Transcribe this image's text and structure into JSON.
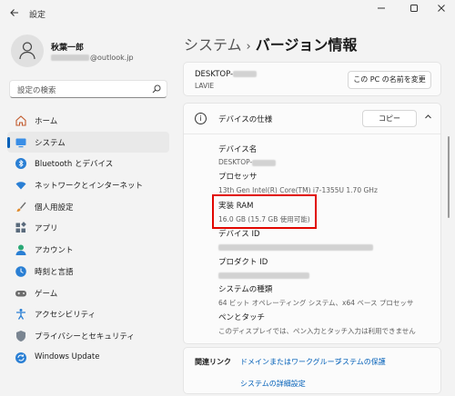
{
  "window": {
    "title": "設定",
    "controls": [
      "minimize",
      "maximize",
      "close"
    ]
  },
  "profile": {
    "name": "秋葉一郎",
    "email_domain": "@outlook.jp"
  },
  "search": {
    "placeholder": "設定の検索"
  },
  "nav": {
    "items": [
      {
        "label": "ホーム",
        "icon": "home-icon"
      },
      {
        "label": "システム",
        "icon": "system-icon",
        "active": true
      },
      {
        "label": "Bluetooth とデバイス",
        "icon": "bluetooth-icon"
      },
      {
        "label": "ネットワークとインターネット",
        "icon": "wifi-icon"
      },
      {
        "label": "個人用設定",
        "icon": "brush-icon"
      },
      {
        "label": "アプリ",
        "icon": "apps-icon"
      },
      {
        "label": "アカウント",
        "icon": "account-icon"
      },
      {
        "label": "時刻と言語",
        "icon": "clock-globe-icon"
      },
      {
        "label": "ゲーム",
        "icon": "gamepad-icon"
      },
      {
        "label": "アクセシビリティ",
        "icon": "accessibility-icon"
      },
      {
        "label": "プライバシーとセキュリティ",
        "icon": "shield-icon"
      },
      {
        "label": "Windows Update",
        "icon": "update-icon"
      }
    ]
  },
  "breadcrumb": {
    "parent": "システム",
    "separator": "›",
    "current": "バージョン情報"
  },
  "device": {
    "name_prefix": "DESKTOP-",
    "model": "LAVIE",
    "rename_button": "この PC の名前を変更"
  },
  "specs": {
    "title": "デバイスの仕様",
    "copy_button": "コピー",
    "rows": [
      {
        "label": "デバイス名",
        "value": "DESKTOP-"
      },
      {
        "label": "プロセッサ",
        "value": "13th Gen Intel(R) Core(TM) i7-1355U   1.70 GHz"
      },
      {
        "label": "実装 RAM",
        "value": "16.0 GB (15.7 GB 使用可能)"
      },
      {
        "label": "デバイス ID",
        "value": ""
      },
      {
        "label": "プロダクト ID",
        "value": ""
      },
      {
        "label": "システムの種類",
        "value": "64 ビット オペレーティング システム、x64 ベース プロセッサ"
      },
      {
        "label": "ペンとタッチ",
        "value": "このディスプレイでは、ペン入力とタッチ入力は利用できません"
      }
    ]
  },
  "related": {
    "label": "関連リンク",
    "links": [
      "ドメインまたはワークグループ",
      "システムの保護",
      "システムの詳細設定"
    ]
  },
  "colors": {
    "accent": "#005fb8",
    "highlight": "#e10600",
    "background": "#f3f3f3"
  }
}
